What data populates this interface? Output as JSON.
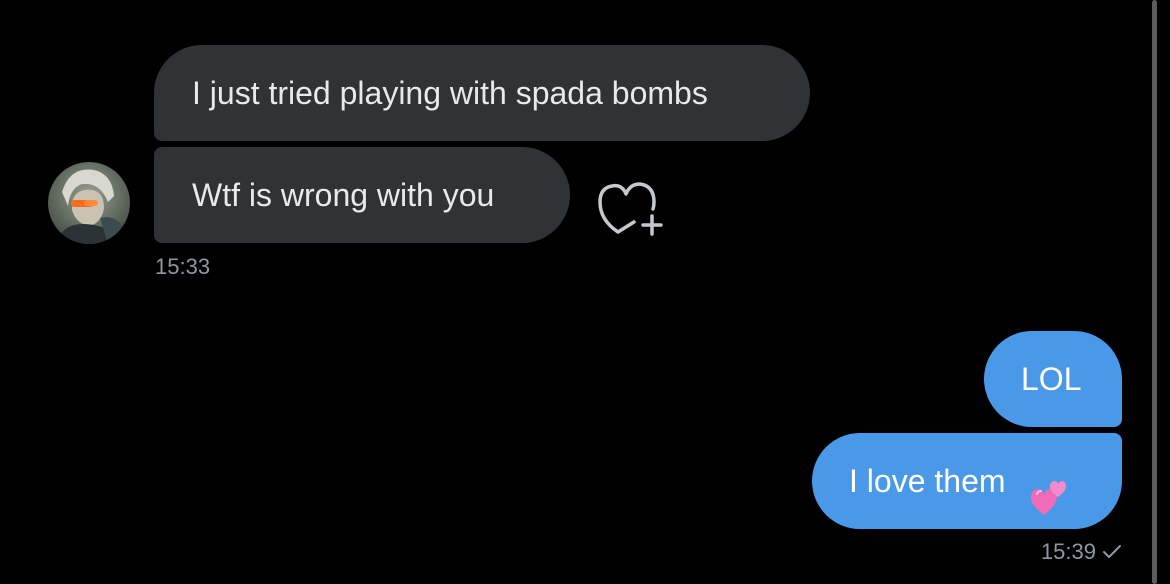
{
  "colors": {
    "background": "#000000",
    "incoming_bubble": "#2f3336",
    "outgoing_bubble": "#4a99e9",
    "timestamp": "#8b98a5"
  },
  "conversation": {
    "incoming": {
      "messages": [
        {
          "text": "I just tried playing with spada bombs"
        },
        {
          "text": "Wtf is wrong with you"
        }
      ],
      "timestamp": "15:33",
      "react_icon": "heart-plus-icon"
    },
    "outgoing": {
      "messages": [
        {
          "text": "LOL"
        },
        {
          "text": "I love them",
          "emoji": "two-hearts-emoji"
        }
      ],
      "timestamp": "15:39",
      "status_icon": "checkmark-icon"
    }
  }
}
